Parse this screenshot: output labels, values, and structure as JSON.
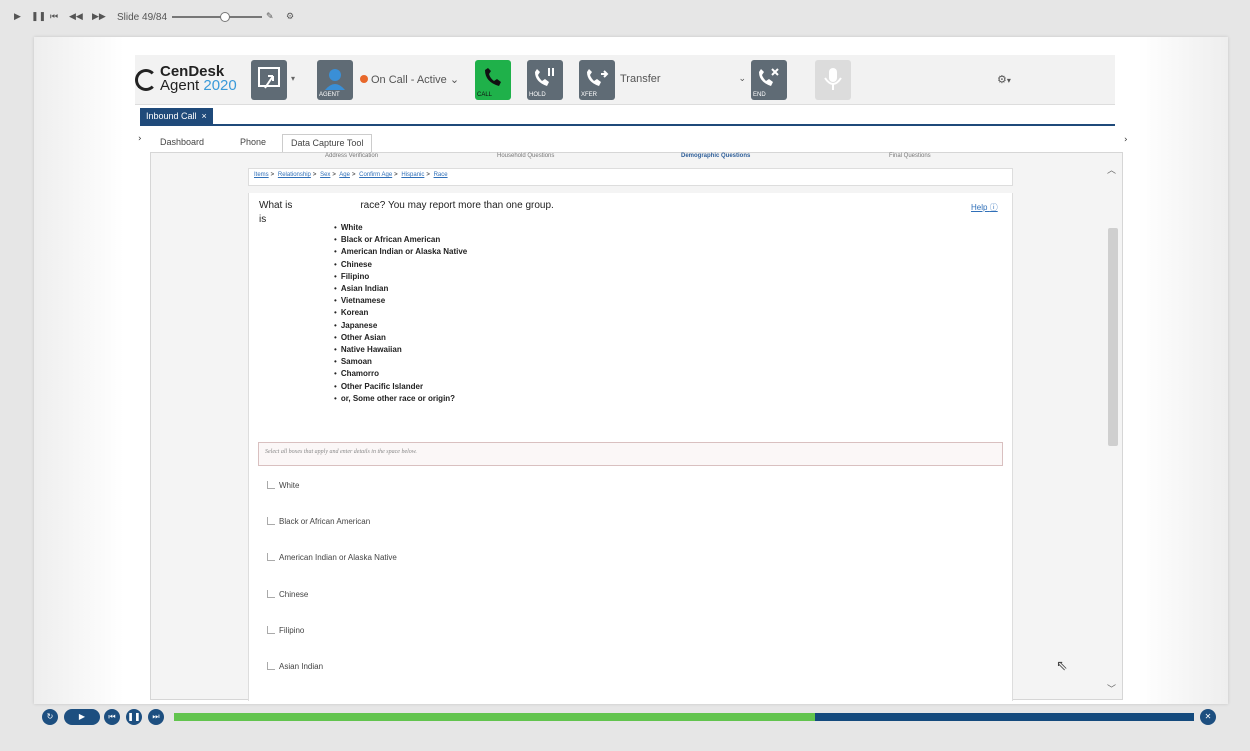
{
  "player": {
    "slide_counter": "Slide 49/84",
    "slide_position": 0.583
  },
  "app": {
    "logo_line1": "CenDesk",
    "logo_line2": "Agent",
    "logo_year": "2020",
    "status": "On Call - Active",
    "transfer": "Transfer",
    "buttons": {
      "agent": "AGENT",
      "call": "CALL",
      "hold": "HOLD",
      "xfer": "XFER",
      "end": "END"
    },
    "colors": {
      "brand_navy": "#1f4a7a",
      "call_green": "#1fb14a",
      "status_orange": "#e8682b",
      "link_blue": "#2f6fb8"
    }
  },
  "tab": {
    "label": "Inbound Call",
    "close": "×"
  },
  "subtabs": [
    "Dashboard",
    "Phone",
    "Data Capture Tool"
  ],
  "sections": {
    "items": [
      "Address Verification",
      "Household Questions",
      "Demographic Questions",
      "Final Questions"
    ],
    "active": "Demographic Questions"
  },
  "breadcrumb": [
    "Items",
    "Relationship",
    "Sex",
    "Age",
    "Confirm Age",
    "Hispanic",
    "Race"
  ],
  "question": {
    "text_start": "What is",
    "text_end": "race? You may report more than one group.",
    "text_line2": "is",
    "help": "Help"
  },
  "race_list": [
    "White",
    "Black or African American",
    "American Indian or Alaska Native",
    "Chinese",
    "Filipino",
    "Asian Indian",
    "Vietnamese",
    "Korean",
    "Japanese",
    "Other Asian",
    "Native Hawaiian",
    "Samoan",
    "Chamorro",
    "Other Pacific Islander",
    "or, Some other race or origin?"
  ],
  "instruction": "Select all boxes that apply and enter details in the space below.",
  "options": [
    "White",
    "Black or African American",
    "American Indian or Alaska Native",
    "Chinese",
    "Filipino",
    "Asian Indian"
  ],
  "progress": {
    "fraction": 0.628
  }
}
